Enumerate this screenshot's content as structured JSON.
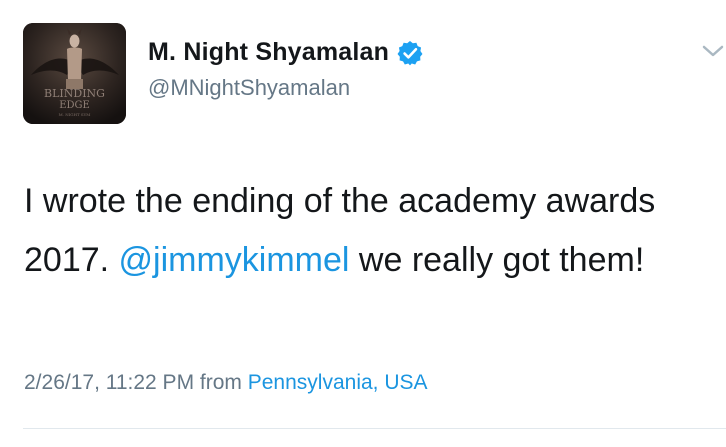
{
  "author": {
    "display_name": "M. Night Shyamalan",
    "handle": "@MNightShyamalan",
    "verified": true,
    "avatar_text_line1": "BLINDING",
    "avatar_text_line2": "EDGE",
    "avatar_text_line3": "M. NIGHT SYM"
  },
  "tweet": {
    "text_before": "I wrote the ending of the academy awards 2017. ",
    "mention": "@jimmykimmel",
    "text_after": " we really got them!"
  },
  "meta": {
    "timestamp": "2/26/17, 11:22 PM",
    "from_label": "from",
    "location": "Pennsylvania, USA"
  },
  "icons": {
    "verified": "verified-badge-icon",
    "menu": "chevron-down-icon"
  },
  "colors": {
    "link": "#1b95e0",
    "verified": "#1da1f2",
    "secondary_text": "#657786",
    "primary_text": "#14171a"
  }
}
